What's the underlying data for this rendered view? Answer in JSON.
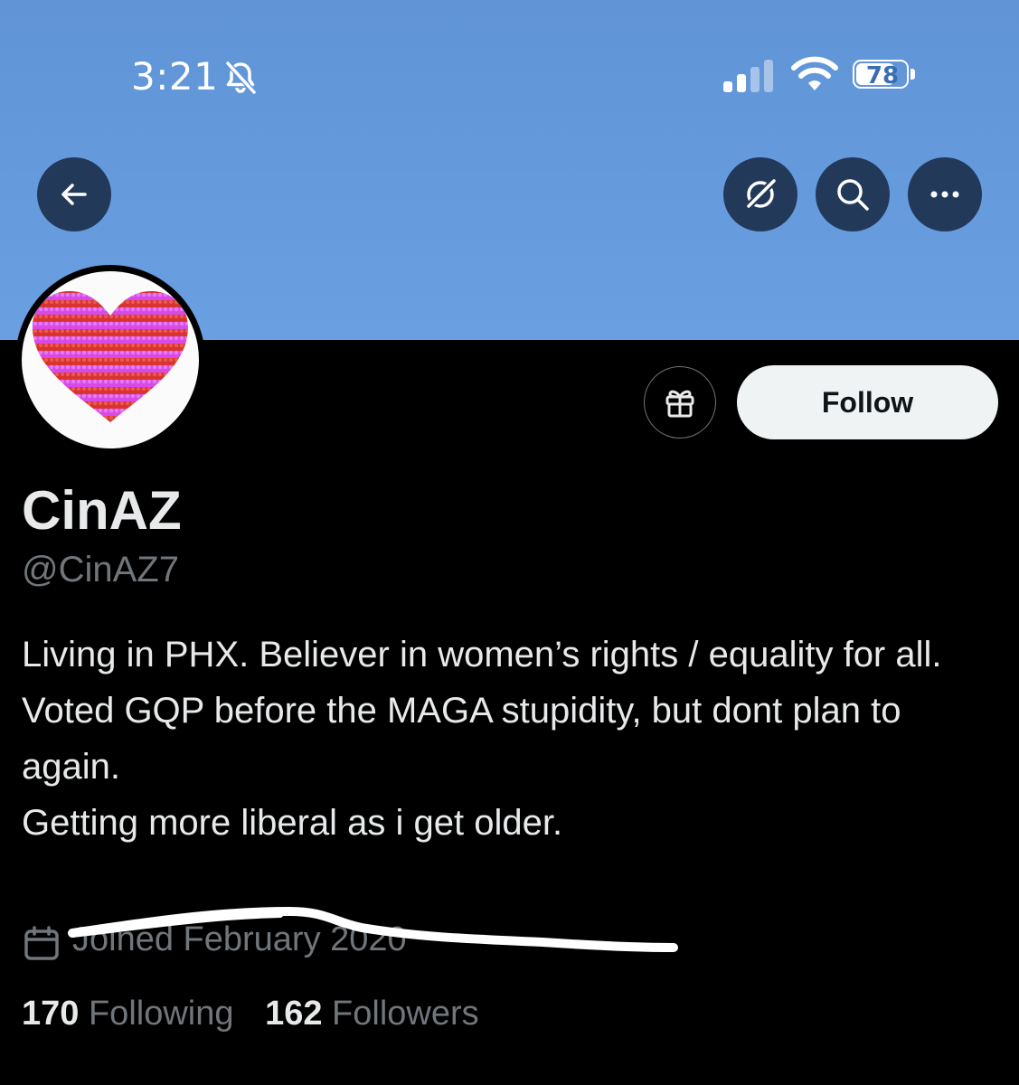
{
  "status_bar": {
    "time": "3:21",
    "battery_level": "78",
    "battery_fraction": 0.78,
    "icons": [
      "bell-slash-icon",
      "signal-icon",
      "wifi-icon",
      "battery-icon"
    ]
  },
  "header": {
    "icons": [
      "back-arrow-icon",
      "grok-icon",
      "search-icon",
      "more-icon"
    ]
  },
  "profile": {
    "display_name": "CinAZ",
    "handle": "@CinAZ7",
    "bio": "Living in PHX. Believer in women’s rights / equality for all.\nVoted GQP before the MAGA stupidity, but dont plan to again.\nGetting more liberal as i get older.",
    "joined": "Joined February 2020",
    "follow_label": "Follow",
    "following_count": "170",
    "following_label": "Following",
    "followers_count": "162",
    "followers_label": "Followers"
  },
  "colors": {
    "banner": "#6aa0e2",
    "header_button_bg": "#22395a",
    "secondary_text": "#71767b",
    "follow_button_bg": "#eff3f4"
  }
}
